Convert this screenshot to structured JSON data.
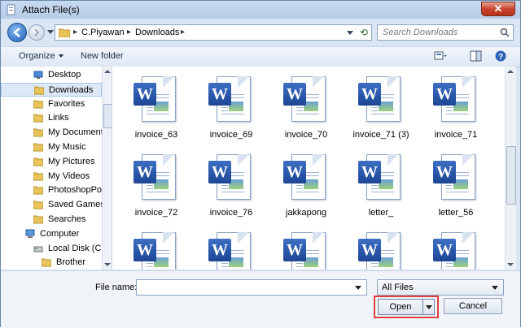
{
  "window": {
    "title": "Attach File(s)"
  },
  "address": {
    "crumbs": [
      "C.Piyawan",
      "Downloads"
    ]
  },
  "search": {
    "placeholder": "Search Downloads"
  },
  "toolbar": {
    "organize_label": "Organize",
    "new_folder_label": "New folder"
  },
  "nav": {
    "items": [
      {
        "label": "Desktop",
        "icon": "desktop-icon"
      },
      {
        "label": "Downloads",
        "icon": "downloads-folder-icon",
        "selected": true
      },
      {
        "label": "Favorites",
        "icon": "favorites-folder-icon"
      },
      {
        "label": "Links",
        "icon": "links-folder-icon"
      },
      {
        "label": "My Documents",
        "icon": "documents-folder-icon"
      },
      {
        "label": "My Music",
        "icon": "music-folder-icon"
      },
      {
        "label": "My Pictures",
        "icon": "pictures-folder-icon"
      },
      {
        "label": "My Videos",
        "icon": "videos-folder-icon"
      },
      {
        "label": "PhotoshopPort",
        "icon": "folder-icon"
      },
      {
        "label": "Saved Games",
        "icon": "saved-games-folder-icon"
      },
      {
        "label": "Searches",
        "icon": "searches-folder-icon"
      },
      {
        "label": "Computer",
        "icon": "computer-icon"
      },
      {
        "label": "Local Disk (C:)",
        "icon": "drive-icon"
      },
      {
        "label": "Brother",
        "icon": "folder-icon"
      }
    ]
  },
  "files": [
    {
      "name": "invoice_63",
      "icon": "word-document-icon"
    },
    {
      "name": "invoice_69",
      "icon": "word-document-icon"
    },
    {
      "name": "invoice_70",
      "icon": "word-document-icon"
    },
    {
      "name": "invoice_71 (3)",
      "icon": "word-document-icon"
    },
    {
      "name": "invoice_71",
      "icon": "word-document-icon"
    },
    {
      "name": "invoice_72",
      "icon": "word-document-icon"
    },
    {
      "name": "invoice_76",
      "icon": "word-document-icon"
    },
    {
      "name": "jakkapong",
      "icon": "word-document-icon"
    },
    {
      "name": "letter_",
      "icon": "word-document-icon"
    },
    {
      "name": "letter_56",
      "icon": "word-document-icon"
    },
    {
      "name": "",
      "icon": "word-document-icon"
    },
    {
      "name": "",
      "icon": "word-document-icon"
    },
    {
      "name": "",
      "icon": "word-document-icon"
    },
    {
      "name": "",
      "icon": "word-document-icon"
    },
    {
      "name": "",
      "icon": "word-document-icon"
    }
  ],
  "footer": {
    "file_name_label": "File name:",
    "file_name_value": "",
    "filter_value": "All Files",
    "open_label": "Open",
    "cancel_label": "Cancel"
  },
  "colors": {
    "accent": "#1f5fb5",
    "highlight_border": "#e0403a",
    "selection": "#dde9f7"
  }
}
